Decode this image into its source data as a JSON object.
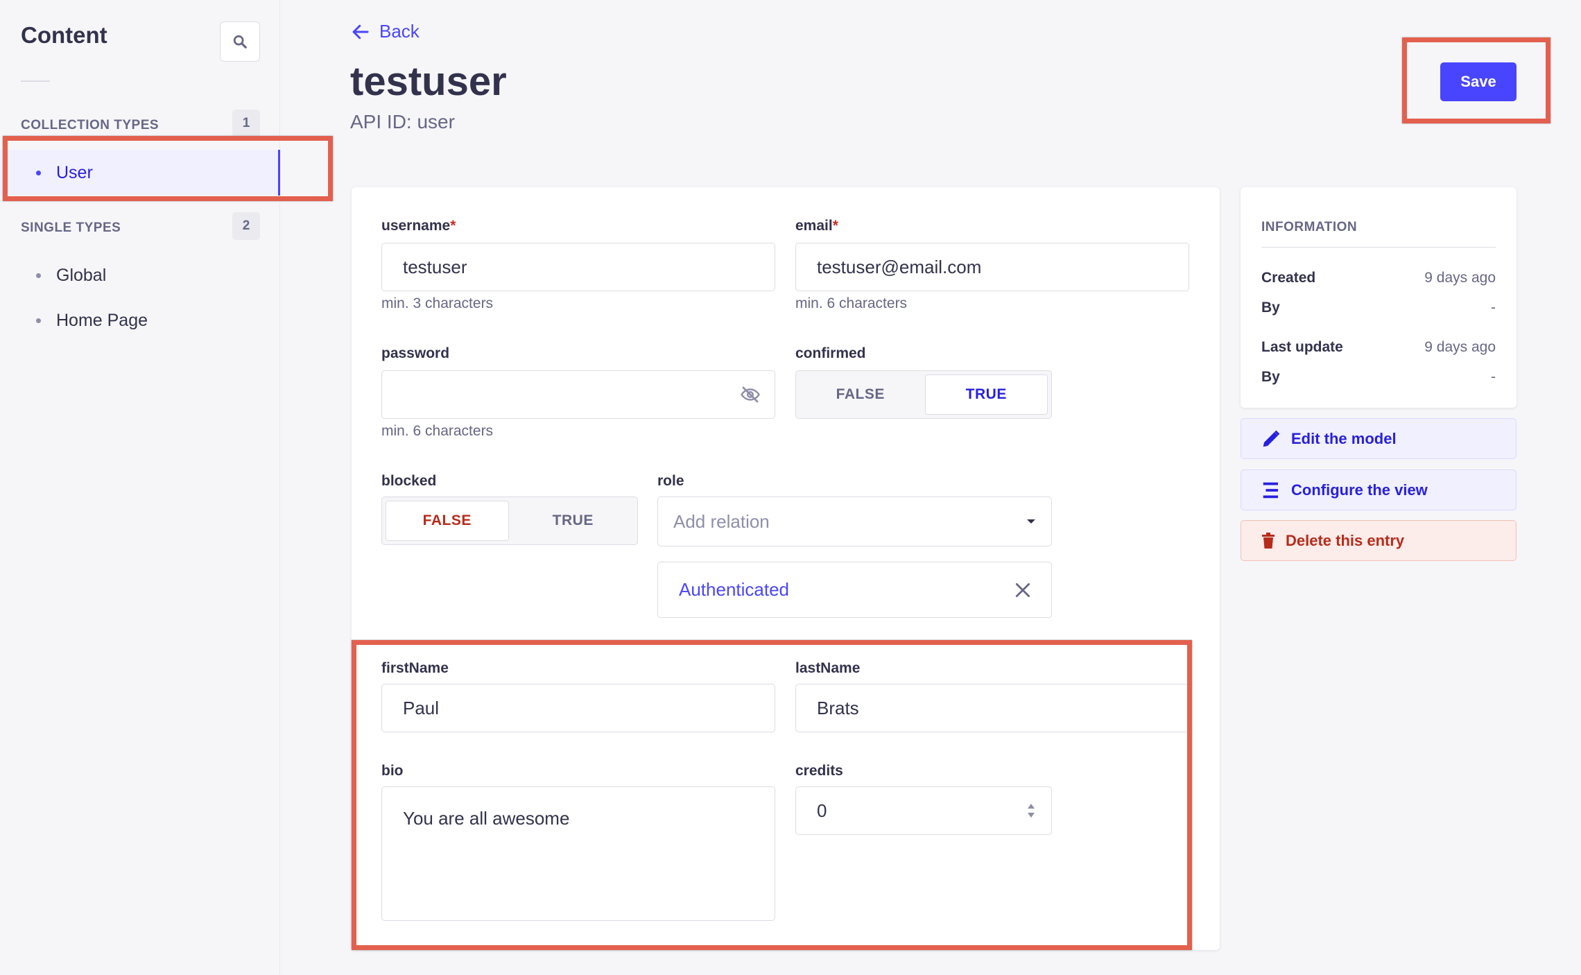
{
  "sidebar": {
    "title": "Content",
    "search_icon": "search-icon",
    "collection_types": {
      "label": "COLLECTION TYPES",
      "count": "1",
      "items": [
        {
          "label": "User",
          "active": true
        }
      ]
    },
    "single_types": {
      "label": "SINGLE TYPES",
      "count": "2",
      "items": [
        {
          "label": "Global"
        },
        {
          "label": "Home Page"
        }
      ]
    }
  },
  "header": {
    "back_label": "Back",
    "title": "testuser",
    "subtitle": "API ID: user",
    "save_label": "Save"
  },
  "form": {
    "username": {
      "label": "username",
      "required": "*",
      "value": "testuser",
      "hint": "min. 3 characters"
    },
    "email": {
      "label": "email",
      "required": "*",
      "value": "testuser@email.com",
      "hint": "min. 6 characters"
    },
    "password": {
      "label": "password",
      "value": "",
      "hint": "min. 6 characters",
      "icon": "eye-off-icon"
    },
    "confirmed": {
      "label": "confirmed",
      "false_label": "FALSE",
      "true_label": "TRUE",
      "selected": "TRUE"
    },
    "blocked": {
      "label": "blocked",
      "false_label": "FALSE",
      "true_label": "TRUE",
      "selected": "FALSE"
    },
    "role": {
      "label": "role",
      "placeholder": "Add relation",
      "selected_item": "Authenticated"
    },
    "firstName": {
      "label": "firstName",
      "value": "Paul"
    },
    "lastName": {
      "label": "lastName",
      "value": "Brats"
    },
    "bio": {
      "label": "bio",
      "value": "You are all awesome"
    },
    "credits": {
      "label": "credits",
      "value": "0"
    }
  },
  "info": {
    "heading": "INFORMATION",
    "created_label": "Created",
    "created_value": "9 days ago",
    "created_by_label": "By",
    "created_by_value": "-",
    "updated_label": "Last update",
    "updated_value": "9 days ago",
    "updated_by_label": "By",
    "updated_by_value": "-"
  },
  "actions": {
    "edit_model": "Edit the model",
    "configure_view": "Configure the view",
    "delete_entry": "Delete this entry"
  },
  "colors": {
    "primary": "#4945ff",
    "danger": "#d02b20",
    "highlight": "#e3604e"
  }
}
